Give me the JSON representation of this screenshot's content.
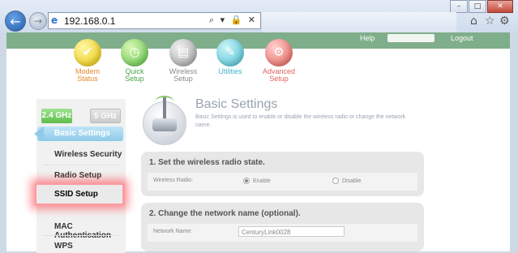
{
  "browser": {
    "url": "192.168.0.1",
    "address_tools": "⌕ ▾ 🔒 ✕",
    "window_buttons": [
      "–",
      "□",
      "✕"
    ],
    "icons": [
      "back-arrow-icon",
      "forward-arrow-icon",
      "ie-logo-icon",
      "home-icon",
      "star-icon",
      "gear-icon"
    ]
  },
  "banner": {
    "help": "Help",
    "logout": "Logout"
  },
  "nav": [
    {
      "label": "Modem\nStatus",
      "icon": "checkmark-icon",
      "color": "#e7c400"
    },
    {
      "label": "Quick\nSetup",
      "icon": "clock-icon",
      "color": "#58c046"
    },
    {
      "label": "Wireless\nSetup",
      "icon": "router-icon",
      "color": "#9c9c9c"
    },
    {
      "label": "Utilities",
      "icon": "tools-icon",
      "color": "#45bfd0"
    },
    {
      "label": "Advanced\nSetup",
      "icon": "gears-icon",
      "color": "#e35a52"
    }
  ],
  "sidebar": {
    "band_24": "2.4 GHz",
    "band_5": "5 GHz",
    "items": [
      {
        "label": "Basic Settings"
      },
      {
        "label": "Wireless Security"
      },
      {
        "label": "Radio Setup"
      },
      {
        "label": "SSID Setup"
      },
      {
        "label": "MAC\nAuthentication"
      },
      {
        "label": "WPS"
      }
    ]
  },
  "main": {
    "title": "Basic Settings",
    "description": "Basic Settings is used to enable or disable the wireless radio or change the network name.",
    "section1": {
      "title": "1. Set the wireless radio state.",
      "label": "Wireless Radio:",
      "option_enable": "Enable",
      "option_disable": "Disable",
      "selected": "Enable"
    },
    "section2": {
      "title": "2. Change the network name (optional).",
      "label": "Network Name:",
      "value": "CenturyLink0028"
    }
  }
}
